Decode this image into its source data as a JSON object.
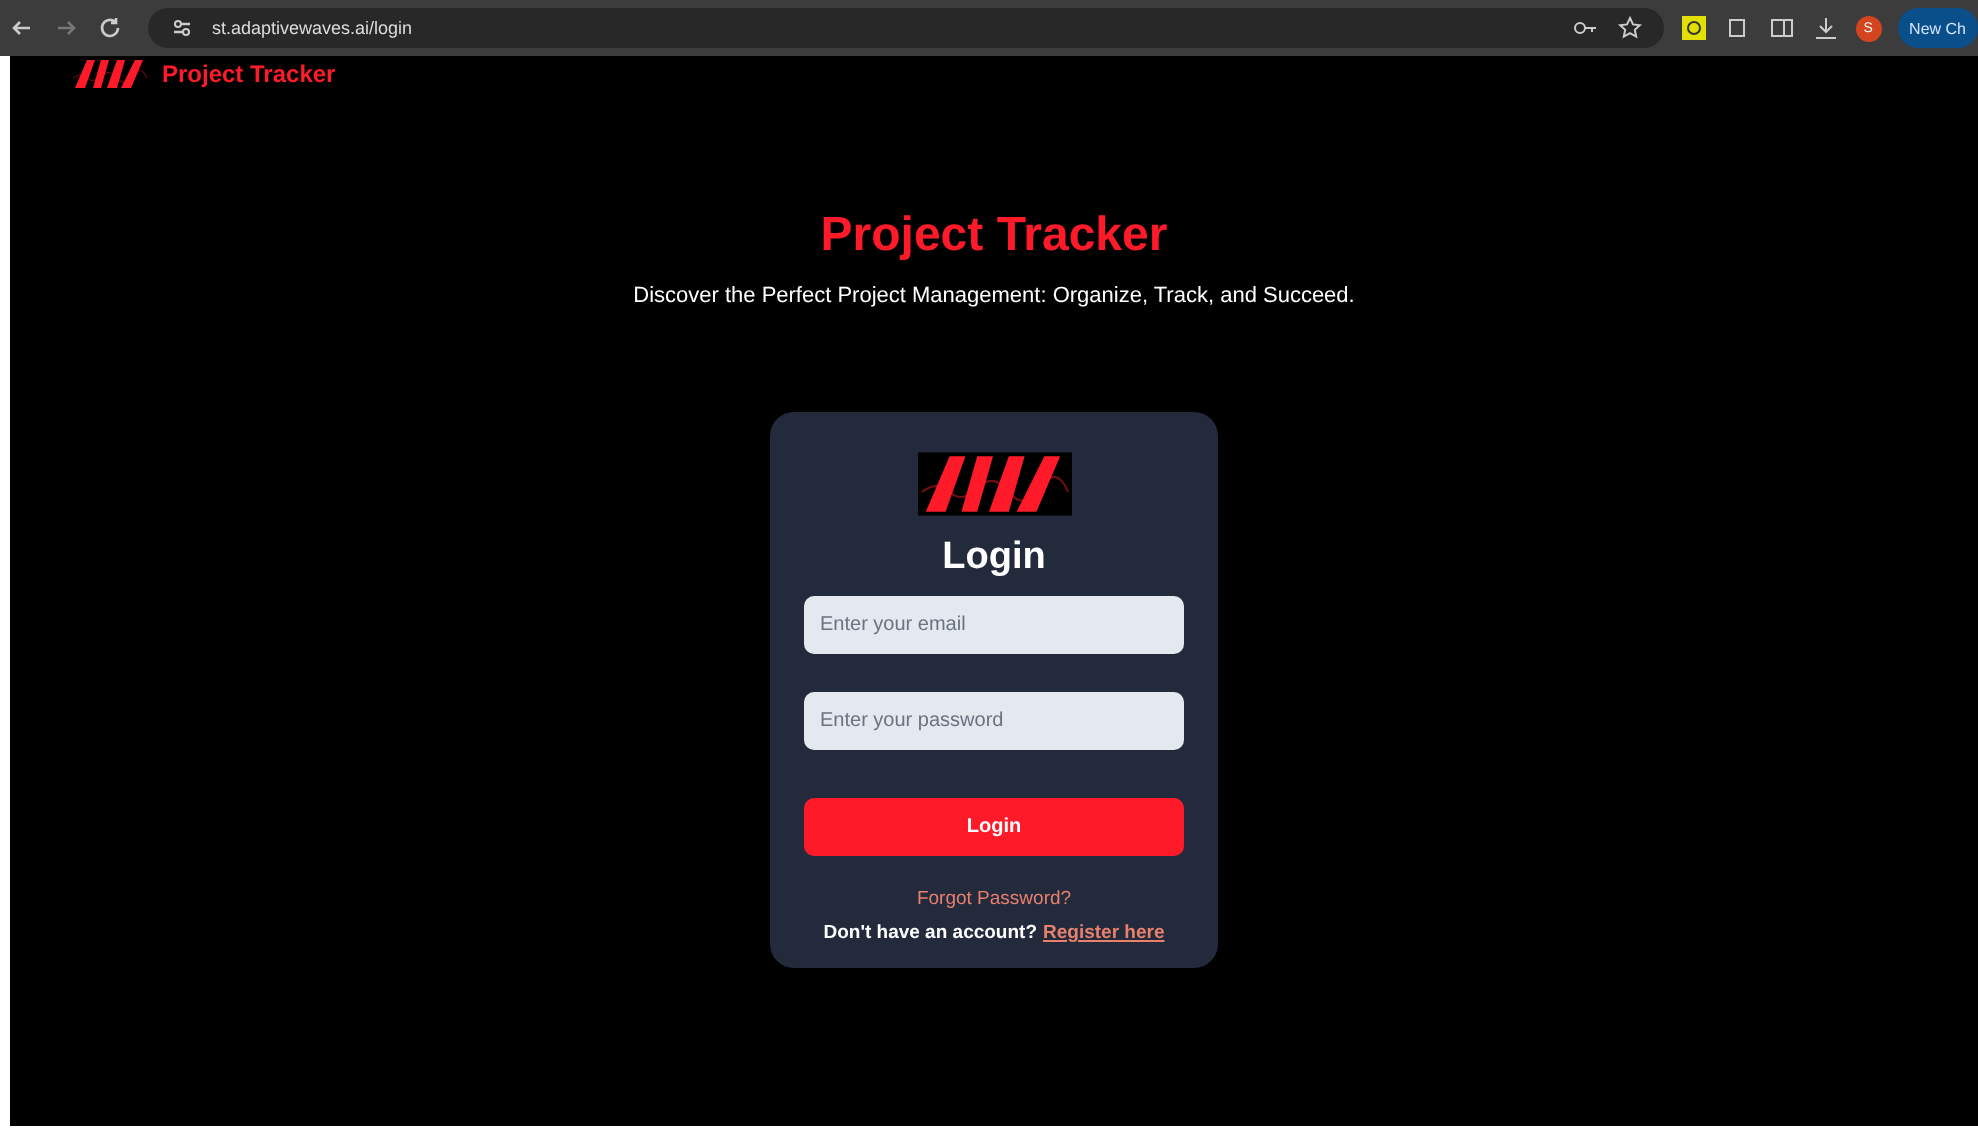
{
  "browser": {
    "url": "st.adaptivewaves.ai/login",
    "profile_initial": "S",
    "new_chat_button": "New Ch"
  },
  "header": {
    "brand": "Project Tracker"
  },
  "hero": {
    "title": "Project Tracker",
    "subtitle": "Discover the Perfect Project Management: Organize, Track, and Succeed."
  },
  "login_card": {
    "title": "Login",
    "fields": [
      {
        "placeholder": "Enter your email"
      },
      {
        "placeholder": "Enter your password"
      }
    ],
    "submit_button": "Login",
    "forgot_link": "Forgot Password?",
    "register_prompt": "Don't have an account?",
    "register_link": "Register here"
  }
}
